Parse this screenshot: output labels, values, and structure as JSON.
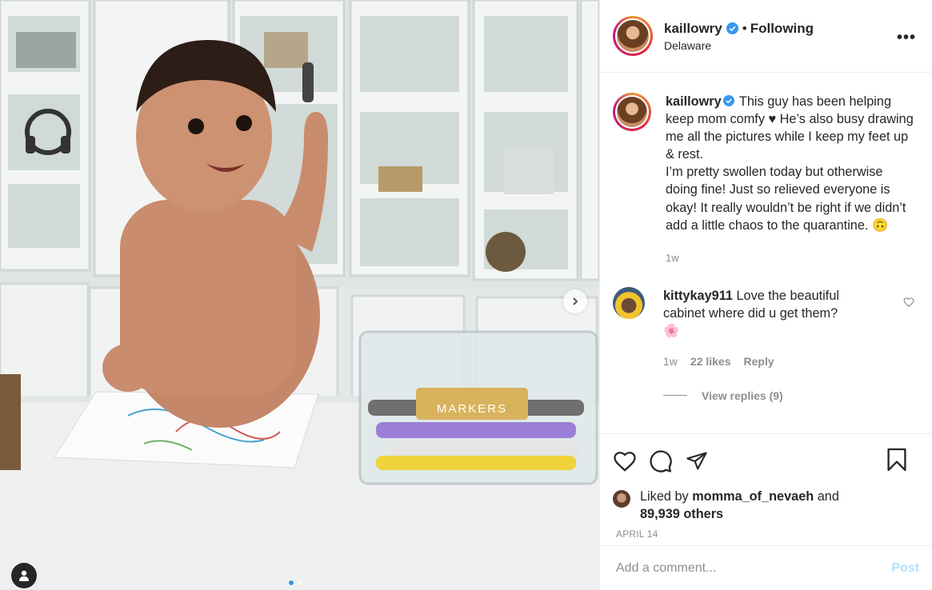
{
  "post": {
    "username": "kaillowry",
    "following_label": "Following",
    "separator": "•",
    "location": "Delaware",
    "more_label": "•••"
  },
  "caption": {
    "username": "kaillowry",
    "text": "This guy has been helping keep mom comfy ♥ He’s also busy drawing me all the pictures while I keep my feet up & rest.\nI’m pretty swollen today but otherwise doing fine! Just so relieved everyone is okay! It really wouldn’t be right if we didn’t add a little chaos to the quarantine. 🙃",
    "time": "1w"
  },
  "comments": [
    {
      "username": "kittykay911",
      "text": "Love the beautiful cabinet where did u get them?",
      "emoji": "🌸",
      "time": "1w",
      "likes": "22 likes",
      "reply_label": "Reply",
      "view_replies": "View replies (9)"
    }
  ],
  "actions": {
    "icons": [
      "heart-icon",
      "comment-icon",
      "share-icon",
      "bookmark-icon"
    ]
  },
  "likes": {
    "prefix": "Liked by",
    "user": "momma_of_nevaeh",
    "and": "and",
    "others": "89,939 others"
  },
  "date": "APRIL 14",
  "add_comment": {
    "placeholder": "Add a comment...",
    "post_label": "Post"
  },
  "photo": {
    "marker_box_label": "MARKERS",
    "carousel_count": 2,
    "carousel_active": 1
  },
  "colors": {
    "verified": "#3897f0",
    "post_disabled": "#b2dffc",
    "muted": "#8e8e8e"
  }
}
